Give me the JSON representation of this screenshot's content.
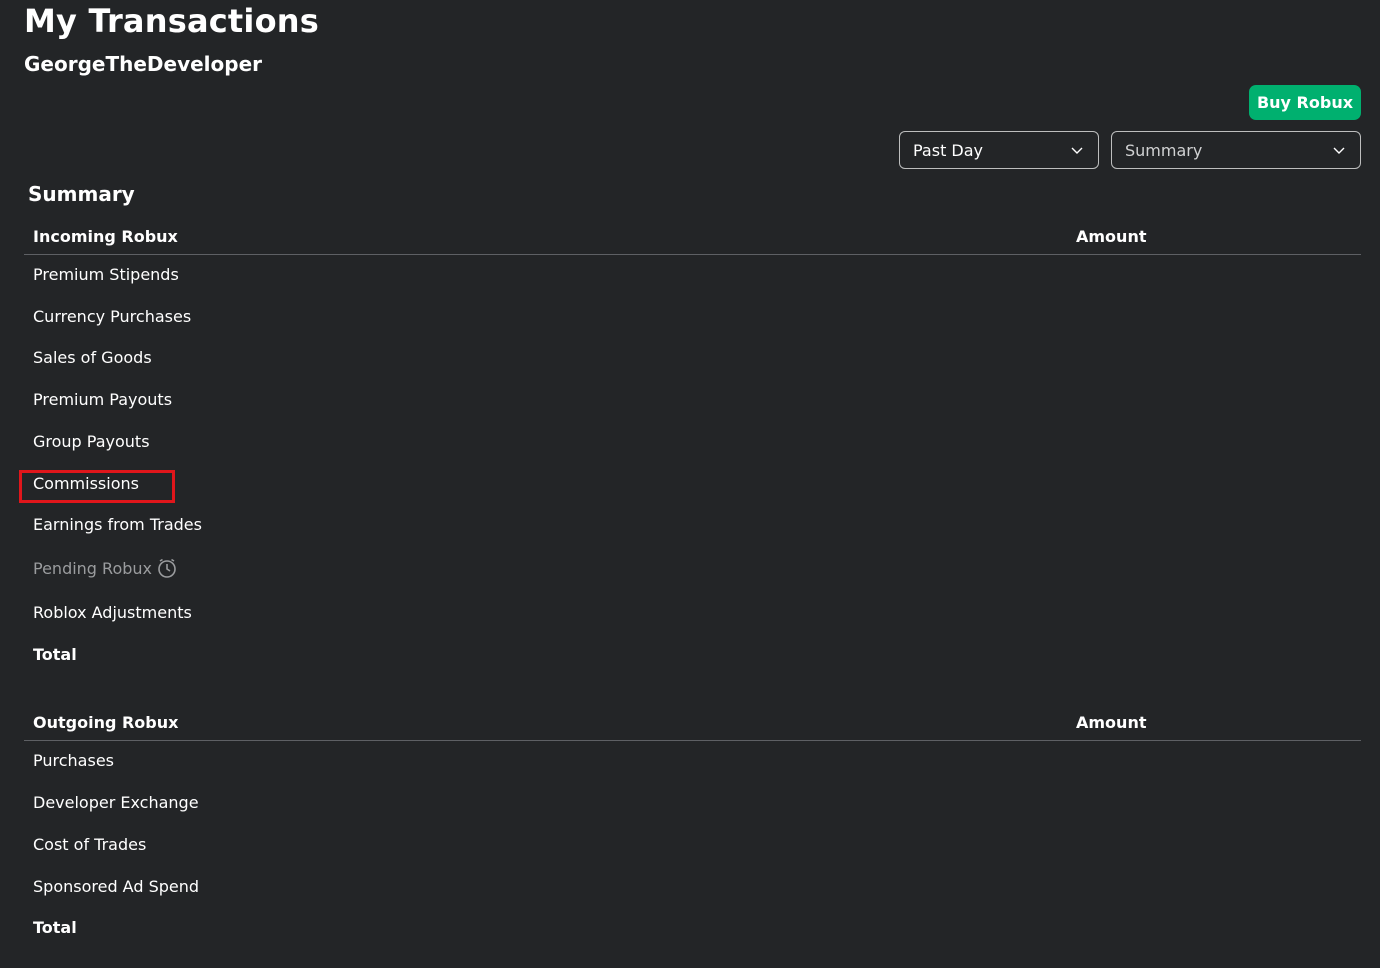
{
  "header": {
    "title": "My Transactions",
    "username": "GeorgeTheDeveloper",
    "buy_button_label": "Buy Robux"
  },
  "filters": {
    "period": {
      "selected": "Past Day"
    },
    "view": {
      "selected": "Summary"
    }
  },
  "summary": {
    "title": "Summary",
    "incoming": {
      "header_label": "Incoming Robux",
      "header_amount": "Amount",
      "rows": [
        {
          "label": "Premium Stipends"
        },
        {
          "label": "Currency Purchases"
        },
        {
          "label": "Sales of Goods"
        },
        {
          "label": "Premium Payouts"
        },
        {
          "label": "Group Payouts"
        },
        {
          "label": "Commissions",
          "highlighted": true
        },
        {
          "label": "Earnings from Trades"
        },
        {
          "label": "Pending Robux",
          "icon": "clock-icon",
          "muted": true
        },
        {
          "label": "Roblox Adjustments"
        },
        {
          "label": "Total",
          "bold": true
        }
      ]
    },
    "outgoing": {
      "header_label": "Outgoing Robux",
      "header_amount": "Amount",
      "rows": [
        {
          "label": "Purchases"
        },
        {
          "label": "Developer Exchange"
        },
        {
          "label": "Cost of Trades"
        },
        {
          "label": "Sponsored Ad Spend"
        },
        {
          "label": "Total",
          "bold": true
        }
      ]
    }
  },
  "colors": {
    "background": "#232527",
    "accent_green": "#00b06f",
    "highlight_red": "#e0161b"
  }
}
